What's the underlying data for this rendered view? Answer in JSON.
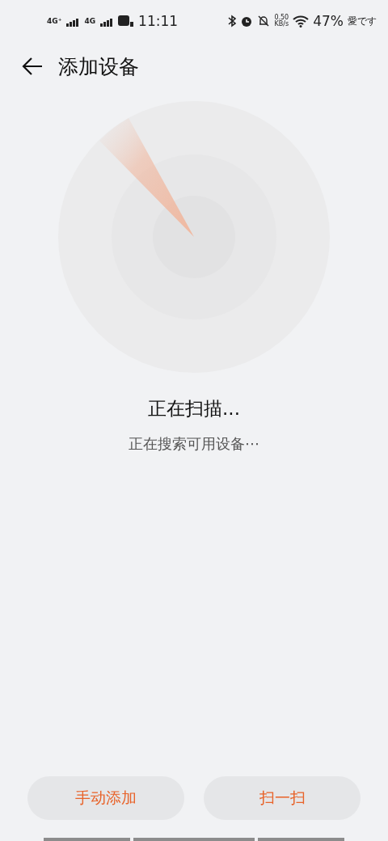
{
  "status_bar": {
    "network_1": "4G⁺",
    "network_2": "4G",
    "time": "11:11",
    "speed": "0.50",
    "speed_unit": "KB/s",
    "battery": "47%",
    "carrier_note": "愛です"
  },
  "header": {
    "title": "添加设备"
  },
  "scan": {
    "title": "正在扫描...",
    "subtitle": "正在搜索可用设备⋯"
  },
  "buttons": [
    {
      "label": "手动添加",
      "kind": "accent"
    },
    {
      "label": "扫一扫",
      "kind": "accent"
    }
  ]
}
